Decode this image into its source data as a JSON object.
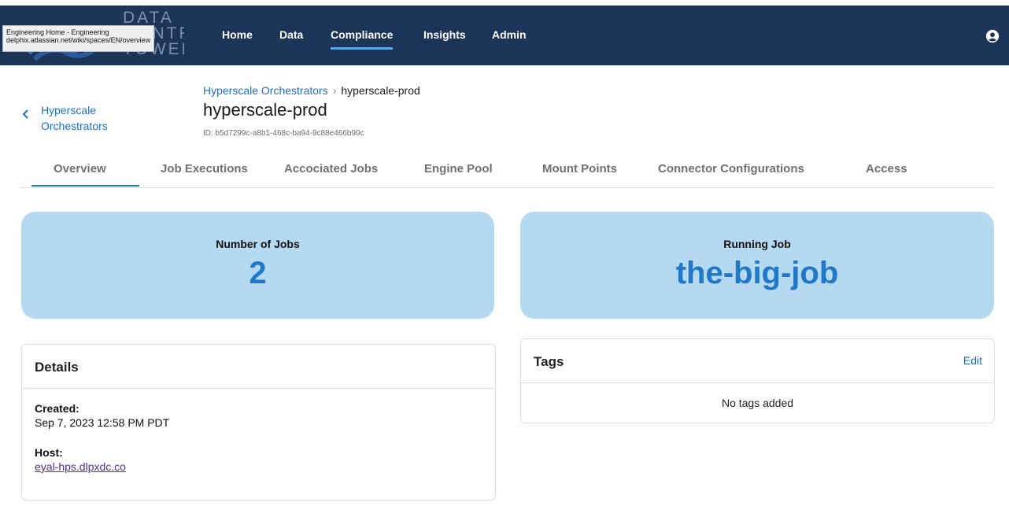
{
  "header": {
    "logo_text": [
      "DATA",
      "CONTROL",
      "TOWER"
    ],
    "tooltip": {
      "line1": "Engineering Home - Engineering",
      "line2": "delphix.atlassian.net/wiki/spaces/EN/overview"
    },
    "nav": [
      {
        "label": "Home",
        "active": false
      },
      {
        "label": "Data",
        "active": false
      },
      {
        "label": "Compliance",
        "active": true
      },
      {
        "label": "Insights",
        "active": false
      },
      {
        "label": "Admin",
        "active": false
      }
    ],
    "user_icon": "user-circle-icon"
  },
  "back": {
    "label": "Hyperscale Orchestrators",
    "icon": "chevron-left-icon"
  },
  "breadcrumb": {
    "parent": "Hyperscale Orchestrators",
    "separator": "›",
    "current": "hyperscale-prod"
  },
  "page": {
    "title": "hyperscale-prod",
    "id": "ID: b5d7299c-a8b1-468c-ba94-9c88e466b90c"
  },
  "tabs": [
    {
      "label": "Overview",
      "active": true
    },
    {
      "label": "Job Executions",
      "active": false
    },
    {
      "label": "Accociated Jobs",
      "active": false
    },
    {
      "label": "Engine Pool",
      "active": false
    },
    {
      "label": "Mount Points",
      "active": false
    },
    {
      "label": "Connector Configurations",
      "active": false
    },
    {
      "label": "Access",
      "active": false
    }
  ],
  "stats": {
    "jobs": {
      "label": "Number of Jobs",
      "value": "2"
    },
    "running": {
      "label": "Running Job",
      "value": "the-big-job"
    }
  },
  "details": {
    "title": "Details",
    "created_label": "Created:",
    "created_value": "Sep 7, 2023 12:58 PM PDT",
    "host_label": "Host:",
    "host_value": "eyal-hps.dlpxdc.co"
  },
  "tags": {
    "title": "Tags",
    "edit_label": "Edit",
    "empty_text": "No tags added"
  },
  "colors": {
    "header_bg": "#1c3457",
    "accent": "#1f78c8",
    "stat_bg": "#b6d9f2"
  }
}
